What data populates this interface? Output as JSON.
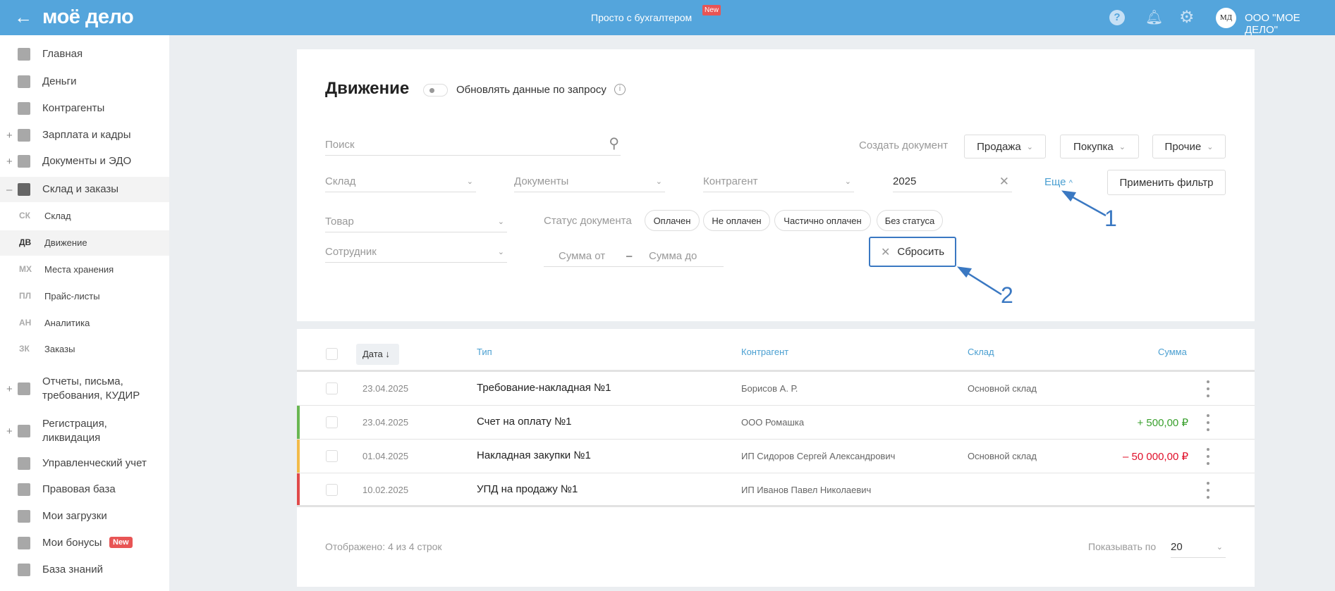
{
  "header": {
    "logo": "моё дело",
    "center_link": "Просто с бухгалтером",
    "center_badge": "New",
    "avatar": "МД",
    "company": "ООО \"МОЕ ДЕЛО\"",
    "accent": "#54a5dc"
  },
  "sidebar": {
    "items": [
      {
        "label": "Главная",
        "icon": "home-icon",
        "expand": ""
      },
      {
        "label": "Деньги",
        "icon": "money-icon",
        "expand": ""
      },
      {
        "label": "Контрагенты",
        "icon": "person-icon",
        "expand": ""
      },
      {
        "label": "Зарплата и кадры",
        "icon": "wallet-icon",
        "expand": "+"
      },
      {
        "label": "Документы и ЭДО",
        "icon": "folder-icon",
        "expand": "+"
      },
      {
        "label": "Склад и заказы",
        "icon": "warehouse-icon",
        "expand": "–"
      }
    ],
    "sub": [
      {
        "abbr": "СК",
        "label": "Склад"
      },
      {
        "abbr": "ДВ",
        "label": "Движение"
      },
      {
        "abbr": "МХ",
        "label": "Места хранения"
      },
      {
        "abbr": "ПЛ",
        "label": "Прайс-листы"
      },
      {
        "abbr": "АН",
        "label": "Аналитика"
      },
      {
        "abbr": "ЗК",
        "label": "Заказы"
      }
    ],
    "items2": [
      {
        "label": "Отчеты, письма, требования, КУДИР",
        "icon": "report-icon",
        "expand": "+"
      },
      {
        "label": "Регистрация, ликвидация",
        "icon": "registration-icon",
        "expand": "+"
      },
      {
        "label": "Управленческий учет",
        "icon": "ruble-icon",
        "expand": ""
      },
      {
        "label": "Правовая база",
        "icon": "briefcase-icon",
        "expand": ""
      },
      {
        "label": "Мои загрузки",
        "icon": "folder-icon",
        "expand": ""
      },
      {
        "label": "Мои бонусы",
        "icon": "gift-icon",
        "expand": "",
        "badge": "New"
      },
      {
        "label": "База знаний",
        "icon": "graduation-icon",
        "expand": ""
      }
    ]
  },
  "page": {
    "title": "Движение",
    "toggle_label": "Обновлять данные по запросу"
  },
  "filters": {
    "search_placeholder": "Поиск",
    "create_label": "Создать документ",
    "create_buttons": [
      "Продажа",
      "Покупка",
      "Прочие"
    ],
    "sklad": "Склад",
    "documents": "Документы",
    "contragent": "Контрагент",
    "year": "2025",
    "more": "Еще",
    "apply": "Применить фильтр",
    "tovar": "Товар",
    "employee": "Сотрудник",
    "status_label": "Статус документа",
    "statuses": [
      "Оплачен",
      "Не оплачен",
      "Частично оплачен",
      "Без статуса"
    ],
    "sum_from": "Сумма от",
    "sum_dash": "–",
    "sum_to": "Сумма до",
    "reset": "Сбросить"
  },
  "annotations": [
    "1",
    "2"
  ],
  "table": {
    "columns": [
      "Дата ↓",
      "Тип",
      "Контрагент",
      "Склад",
      "Сумма"
    ],
    "rows": [
      {
        "date": "23.04.2025",
        "type": "Требование-накладная №1",
        "contragent": "Борисов А. Р.",
        "sklad": "Основной склад",
        "sum": "",
        "color": ""
      },
      {
        "date": "23.04.2025",
        "type": "Счет на оплату №1",
        "contragent": "ООО Ромашка",
        "sklad": "",
        "sum": "+ 500,00 ₽",
        "color": "#6ab752"
      },
      {
        "date": "01.04.2025",
        "type": "Накладная закупки №1",
        "contragent": "ИП Сидоров Сергей Александрович",
        "sklad": "Основной склад",
        "sum": "– 50 000,00 ₽",
        "color": "#f2bb4a"
      },
      {
        "date": "10.02.2025",
        "type": "УПД на продажу №1",
        "contragent": "ИП Иванов Павел Николаевич",
        "sklad": "",
        "sum": "",
        "color": "#e04a4a"
      }
    ],
    "footer": "Отображено: 4 из 4 строк",
    "per_page_label": "Показывать по",
    "per_page": "20"
  }
}
